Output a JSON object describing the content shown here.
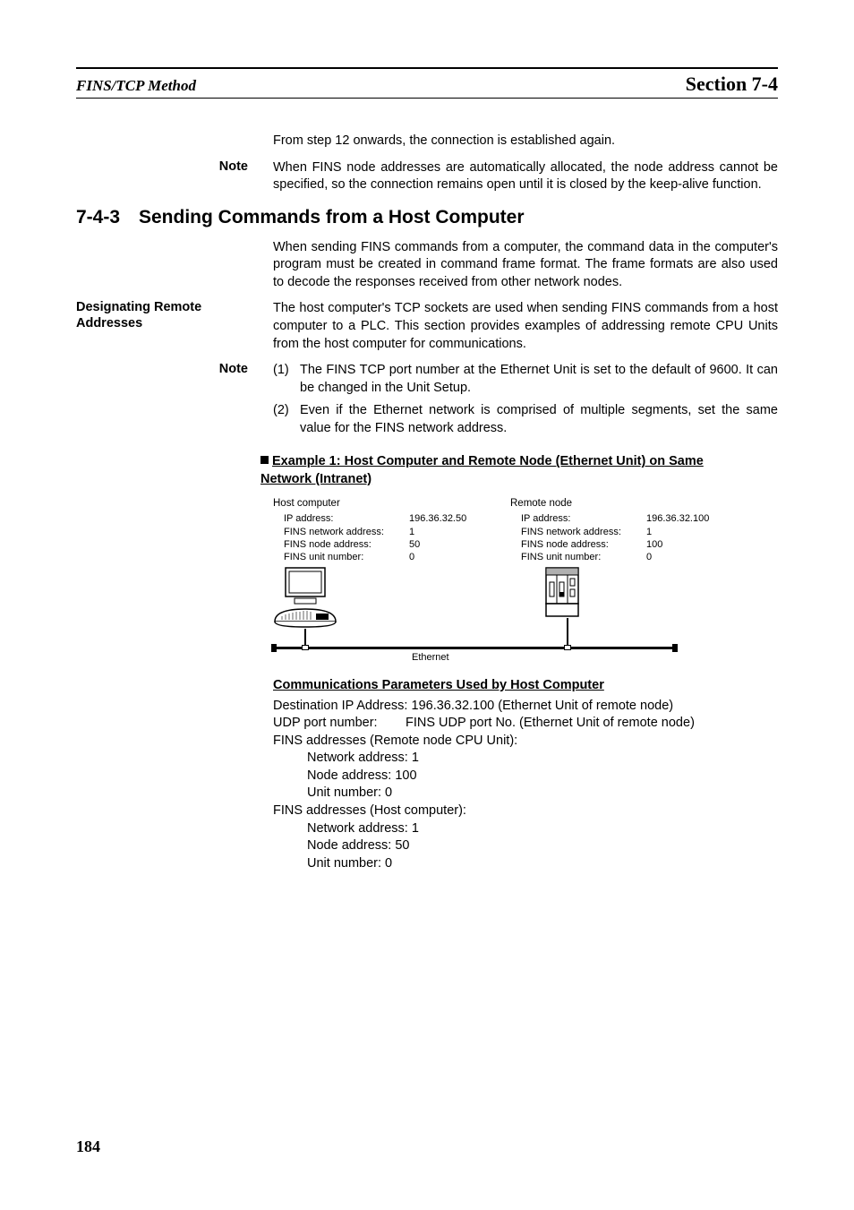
{
  "header": {
    "left": "FINS/TCP Method",
    "right": "Section 7-4"
  },
  "intro_line": "From step 12 onwards, the connection is established again.",
  "note1": {
    "label": "Note",
    "text": "When FINS node addresses are automatically allocated, the node address cannot be specified, so the connection remains open until it is closed by the keep-alive function."
  },
  "section": {
    "number": "7-4-3",
    "title": "Sending Commands from a Host Computer"
  },
  "section_intro": "When sending FINS commands from a computer, the command data in the computer's program must be created in command frame format. The frame formats are also used to decode the responses received from other network nodes.",
  "designating": {
    "label": "Designating Remote Addresses",
    "text": "The host computer's TCP sockets are used when sending FINS commands from a host computer to a PLC. This section provides examples of addressing remote CPU Units from the host computer for communications."
  },
  "note2": {
    "label": "Note",
    "items": [
      {
        "num": "(1)",
        "text": "The FINS TCP port number at the Ethernet Unit is set to the default of 9600. It can be changed in the Unit Setup."
      },
      {
        "num": "(2)",
        "text": "Even if the Ethernet network is comprised of multiple segments, set the same value for the FINS network address."
      }
    ]
  },
  "example1": {
    "heading_line1": "Example 1: Host Computer and Remote Node (Ethernet Unit) on Same ",
    "heading_line2": "Network (Intranet)"
  },
  "diagram": {
    "host": {
      "title": "Host computer",
      "rows": [
        {
          "label": "IP address:",
          "value": "196.36.32.50"
        },
        {
          "label": "FINS network address:",
          "value": "1"
        },
        {
          "label": "FINS node address:",
          "value": "50"
        },
        {
          "label": "FINS unit number:",
          "value": "0"
        }
      ]
    },
    "remote": {
      "title": "Remote node",
      "rows": [
        {
          "label": "IP address:",
          "value": "196.36.32.100"
        },
        {
          "label": "FINS network address:",
          "value": "1"
        },
        {
          "label": "FINS node address:",
          "value": "100"
        },
        {
          "label": "FINS unit number:",
          "value": "0"
        }
      ]
    },
    "ethernet_label": "Ethernet"
  },
  "comm": {
    "heading": "Communications Parameters Used by Host Computer",
    "dest_lbl": "Destination IP Address: ",
    "dest_val": "196.36.32.100 (Ethernet Unit of remote node)",
    "udp_lbl": "UDP port number:",
    "udp_val": "FINS UDP port No. (Ethernet Unit of remote node)",
    "fins_remote": "FINS addresses (Remote node CPU Unit):",
    "remote_net": "Network address: 1",
    "remote_node": "Node address: 100",
    "remote_unit": "Unit number: 0",
    "fins_host": "FINS addresses (Host computer):",
    "host_net": "Network address: 1",
    "host_node": "Node address: 50",
    "host_unit": "Unit number: 0"
  },
  "page_number": "184"
}
